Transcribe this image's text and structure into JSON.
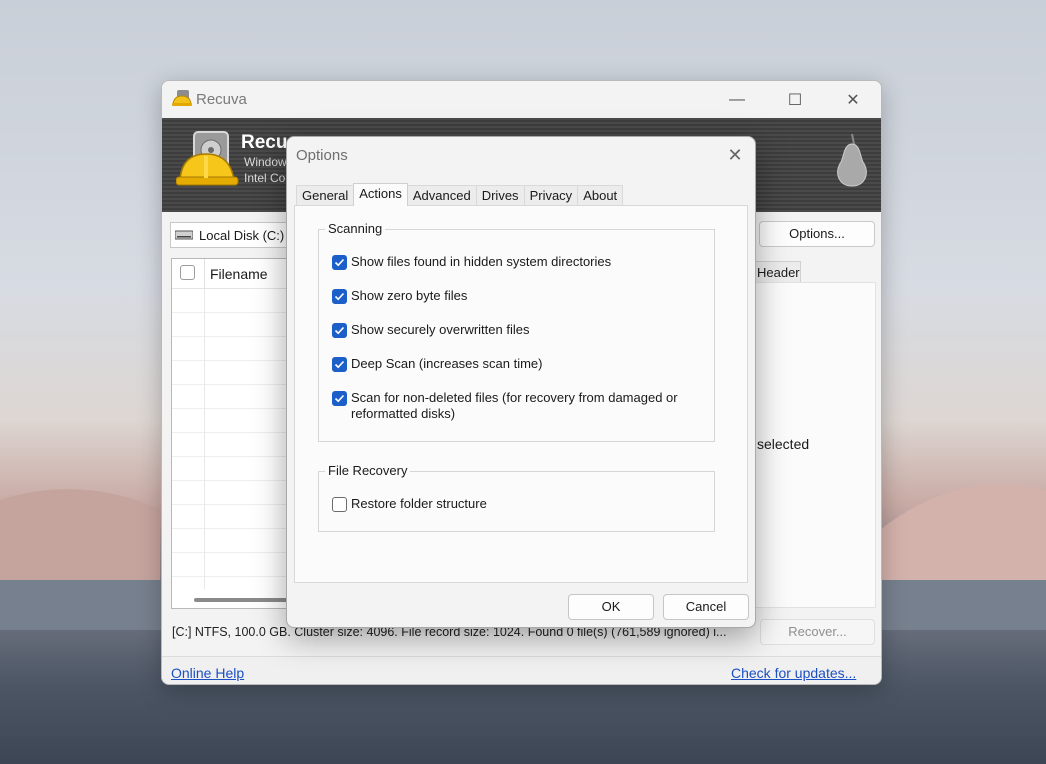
{
  "app": {
    "title": "Recuva",
    "brand": "Recu",
    "sub1": "Window",
    "sub2": "Intel Co",
    "window_controls": {
      "minimize": "—",
      "maximize": "☐",
      "close": "✕"
    }
  },
  "toolbar": {
    "drive_label": "Local Disk (C:)",
    "options_label": "Options..."
  },
  "file_list": {
    "filename_header": "Filename"
  },
  "right_panel": {
    "tab_label": "Header",
    "selected_text": "selected"
  },
  "status": {
    "text": "[C:] NTFS, 100.0 GB. Cluster size: 4096. File record size: 1024. Found 0 file(s) (761,589 ignored) i...",
    "recover_label": "Recover..."
  },
  "footer": {
    "help_link": "Online Help",
    "updates_link": "Check for updates..."
  },
  "dialog": {
    "title": "Options",
    "close_glyph": "✕",
    "tabs": [
      "General",
      "Actions",
      "Advanced",
      "Drives",
      "Privacy",
      "About"
    ],
    "active_tab": "Actions",
    "scanning": {
      "legend": "Scanning",
      "options": [
        {
          "label": "Show files found in hidden system directories",
          "checked": true
        },
        {
          "label": "Show zero byte files",
          "checked": true
        },
        {
          "label": "Show securely overwritten files",
          "checked": true
        },
        {
          "label": "Deep Scan (increases scan time)",
          "checked": true
        },
        {
          "label": "Scan for non-deleted files (for recovery from damaged or reformatted disks)",
          "checked": true
        }
      ]
    },
    "file_recovery": {
      "legend": "File Recovery",
      "options": [
        {
          "label": "Restore folder structure",
          "checked": false
        }
      ]
    },
    "ok_label": "OK",
    "cancel_label": "Cancel"
  },
  "colors": {
    "accent": "#1d5fc9",
    "link": "#1b4fc4",
    "banner": "#444444"
  }
}
